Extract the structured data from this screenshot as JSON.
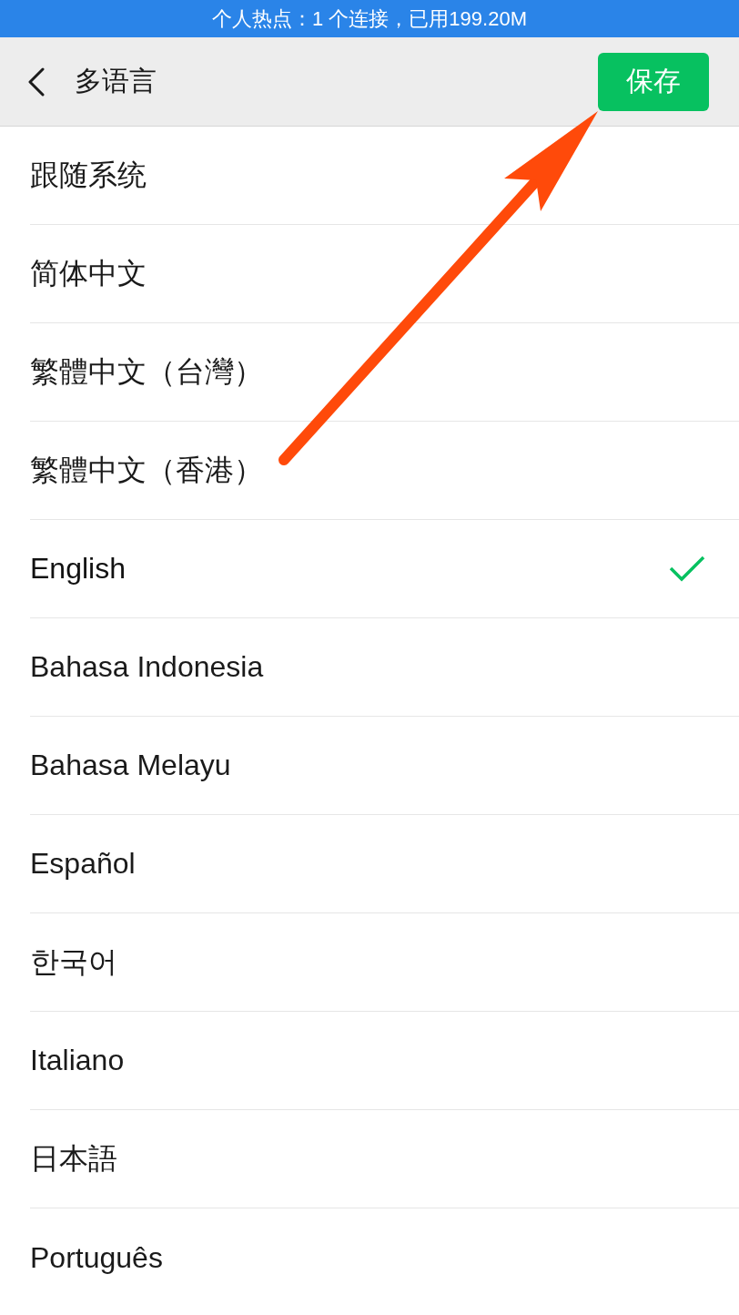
{
  "status_bar": {
    "text": "个人热点：1 个连接，已用199.20M"
  },
  "header": {
    "title": "多语言",
    "save_button": "保存"
  },
  "languages": [
    {
      "label": "跟随系统",
      "selected": false
    },
    {
      "label": "简体中文",
      "selected": false
    },
    {
      "label": "繁體中文（台灣）",
      "selected": false
    },
    {
      "label": "繁體中文（香港）",
      "selected": false
    },
    {
      "label": "English",
      "selected": true
    },
    {
      "label": "Bahasa Indonesia",
      "selected": false
    },
    {
      "label": "Bahasa Melayu",
      "selected": false
    },
    {
      "label": "Español",
      "selected": false
    },
    {
      "label": "한국어",
      "selected": false
    },
    {
      "label": "Italiano",
      "selected": false
    },
    {
      "label": "日本語",
      "selected": false
    },
    {
      "label": "Português",
      "selected": false
    }
  ],
  "annotations": [
    {
      "kind": "arrow"
    }
  ]
}
